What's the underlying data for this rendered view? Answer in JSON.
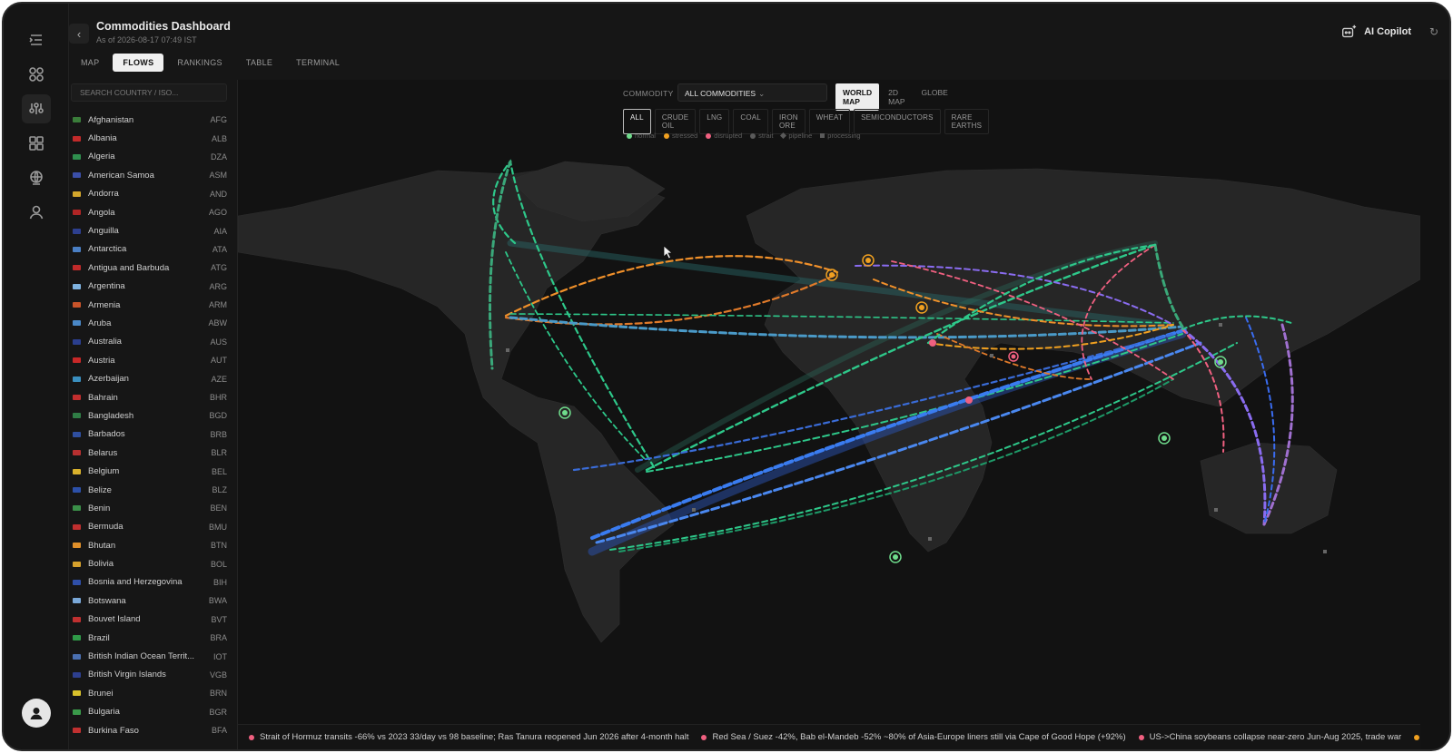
{
  "header": {
    "title": "Commodities Dashboard",
    "subtitle": "As of 2026-08-17 07:49 IST",
    "copilot_label": "AI Copilot",
    "tabs": [
      {
        "label": "MAP",
        "active": false
      },
      {
        "label": "FLOWS",
        "active": true
      },
      {
        "label": "RANKINGS",
        "active": false
      },
      {
        "label": "TABLE",
        "active": false
      },
      {
        "label": "TERMINAL",
        "active": false
      }
    ]
  },
  "sidebar": {
    "search_placeholder": "SEARCH COUNTRY / ISO...",
    "countries": [
      {
        "name": "Afghanistan",
        "iso": "AFG",
        "flag": "#3a7d3a"
      },
      {
        "name": "Albania",
        "iso": "ALB",
        "flag": "#c22a2a"
      },
      {
        "name": "Algeria",
        "iso": "DZA",
        "flag": "#2f8f4e"
      },
      {
        "name": "American Samoa",
        "iso": "ASM",
        "flag": "#3b4fa8"
      },
      {
        "name": "Andorra",
        "iso": "AND",
        "flag": "#d4a72c"
      },
      {
        "name": "Angola",
        "iso": "AGO",
        "flag": "#b02525"
      },
      {
        "name": "Anguilla",
        "iso": "AIA",
        "flag": "#2d3f8f"
      },
      {
        "name": "Antarctica",
        "iso": "ATA",
        "flag": "#4a7fc4"
      },
      {
        "name": "Antigua and Barbuda",
        "iso": "ATG",
        "flag": "#c02a2a"
      },
      {
        "name": "Argentina",
        "iso": "ARG",
        "flag": "#7fb3e0"
      },
      {
        "name": "Armenia",
        "iso": "ARM",
        "flag": "#c9542a"
      },
      {
        "name": "Aruba",
        "iso": "ABW",
        "flag": "#4a88c7"
      },
      {
        "name": "Australia",
        "iso": "AUS",
        "flag": "#2b3f8f"
      },
      {
        "name": "Austria",
        "iso": "AUT",
        "flag": "#c82828"
      },
      {
        "name": "Azerbaijan",
        "iso": "AZE",
        "flag": "#3a8fbf"
      },
      {
        "name": "Bahrain",
        "iso": "BHR",
        "flag": "#c22e2e"
      },
      {
        "name": "Bangladesh",
        "iso": "BGD",
        "flag": "#2f7d45"
      },
      {
        "name": "Barbados",
        "iso": "BRB",
        "flag": "#2f4fa0"
      },
      {
        "name": "Belarus",
        "iso": "BLR",
        "flag": "#b83030"
      },
      {
        "name": "Belgium",
        "iso": "BEL",
        "flag": "#d9b12c"
      },
      {
        "name": "Belize",
        "iso": "BLZ",
        "flag": "#2c50a8"
      },
      {
        "name": "Benin",
        "iso": "BEN",
        "flag": "#3a8f48"
      },
      {
        "name": "Bermuda",
        "iso": "BMU",
        "flag": "#c02f2f"
      },
      {
        "name": "Bhutan",
        "iso": "BTN",
        "flag": "#e0902a"
      },
      {
        "name": "Bolivia",
        "iso": "BOL",
        "flag": "#d6a12c"
      },
      {
        "name": "Bosnia and Herzegovina",
        "iso": "BIH",
        "flag": "#2f4fa8"
      },
      {
        "name": "Botswana",
        "iso": "BWA",
        "flag": "#7aa8d8"
      },
      {
        "name": "Bouvet Island",
        "iso": "BVT",
        "flag": "#c03030"
      },
      {
        "name": "Brazil",
        "iso": "BRA",
        "flag": "#2f9a48"
      },
      {
        "name": "British Indian Ocean Territ...",
        "iso": "IOT",
        "flag": "#4a6fb0"
      },
      {
        "name": "British Virgin Islands",
        "iso": "VGB",
        "flag": "#2d3f8f"
      },
      {
        "name": "Brunei",
        "iso": "BRN",
        "flag": "#d9c22c"
      },
      {
        "name": "Bulgaria",
        "iso": "BGR",
        "flag": "#3a9a4a"
      },
      {
        "name": "Burkina Faso",
        "iso": "BFA",
        "flag": "#c03030"
      }
    ]
  },
  "controls": {
    "commodity_label": "COMMODITY",
    "commodity_value": "ALL COMMODITIES",
    "views": [
      {
        "label": "WORLD MAP",
        "active": true
      },
      {
        "label": "2D MAP",
        "active": false
      },
      {
        "label": "GLOBE",
        "active": false
      }
    ],
    "chips": [
      {
        "label": "ALL",
        "active": true
      },
      {
        "label": "CRUDE OIL",
        "active": false
      },
      {
        "label": "LNG",
        "active": false
      },
      {
        "label": "COAL",
        "active": false
      },
      {
        "label": "IRON ORE",
        "active": false
      },
      {
        "label": "WHEAT",
        "active": false
      },
      {
        "label": "SEMICONDUCTORS",
        "active": false
      },
      {
        "label": "RARE EARTHS",
        "active": false
      }
    ],
    "legend": [
      {
        "label": "normal",
        "shape": "dot",
        "color": "#6fdc8c"
      },
      {
        "label": "stressed",
        "shape": "dot",
        "color": "#f0a020"
      },
      {
        "label": "disrupted",
        "shape": "dot",
        "color": "#f06080"
      },
      {
        "label": "strait",
        "shape": "dot",
        "color": "#5a5a5a"
      },
      {
        "label": "pipeline",
        "shape": "diamond",
        "color": "#5a5a5a"
      },
      {
        "label": "processing",
        "shape": "square",
        "color": "#5a5a5a"
      }
    ]
  },
  "colors": {
    "normal": "#6fdc8c",
    "stressed": "#f0a020",
    "disrupted": "#f06080",
    "flow_green": "#2ec88a",
    "flow_blue": "#3a7cf0",
    "flow_purple": "#8a6cf0",
    "flow_orange": "#f0902a"
  },
  "ticker": [
    {
      "text": "Strait of Hormuz transits -66% vs 2023  33/day vs 98 baseline; Ras Tanura reopened Jun 2026 after 4-month halt",
      "color": "#f06080"
    },
    {
      "text": "Red Sea / Suez -42%, Bab el-Mandeb -52%  ~80% of Asia-Europe liners still via Cape of Good Hope (+92%)",
      "color": "#f06080"
    },
    {
      "text": "US->China soybeans collapse  near-zero Jun-Aug 2025, trade war",
      "color": "#f06080"
    },
    {
      "text": "",
      "color": "#f0a020"
    }
  ]
}
